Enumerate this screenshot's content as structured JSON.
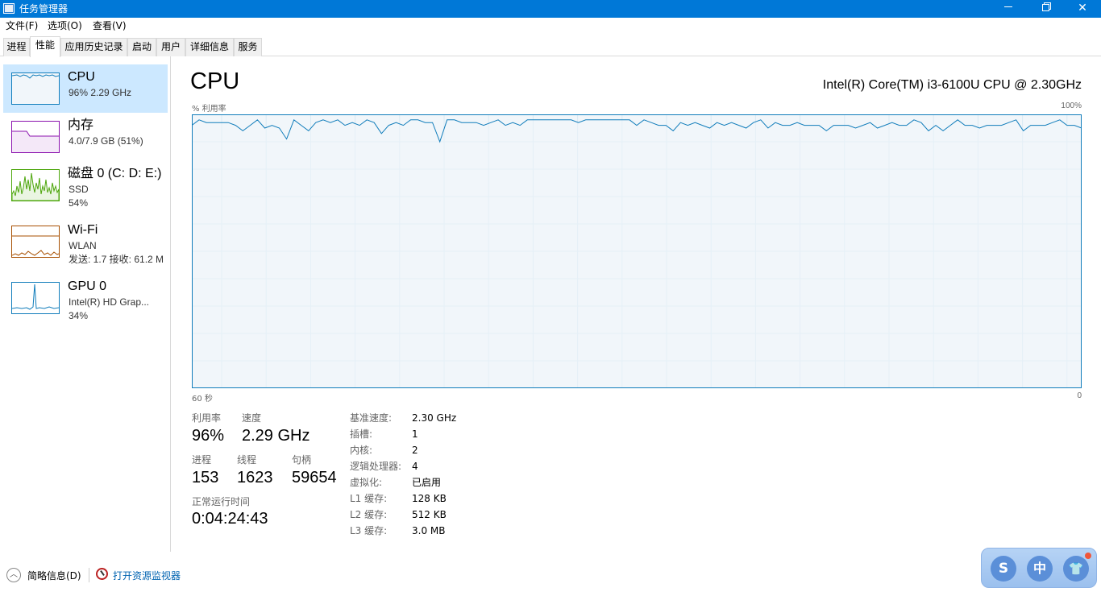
{
  "window": {
    "title": "任务管理器"
  },
  "menu": [
    "文件(F)",
    "选项(O)",
    "查看(V)"
  ],
  "tabs": [
    "进程",
    "性能",
    "应用历史记录",
    "启动",
    "用户",
    "详细信息",
    "服务"
  ],
  "active_tab": "性能",
  "sidebar": {
    "items": [
      {
        "title": "CPU",
        "line1": "96% 2.29 GHz",
        "line2": "",
        "color": "#117dbb"
      },
      {
        "title": "内存",
        "line1": "4.0/7.9 GB (51%)",
        "line2": "",
        "color": "#8b12ae"
      },
      {
        "title": "磁盘 0 (C: D: E:)",
        "line1": "SSD",
        "line2": "54%",
        "color": "#4da60c"
      },
      {
        "title": "Wi-Fi",
        "line1": "WLAN",
        "line2": "发送: 1.7 接收: 61.2 M",
        "color": "#a74f01"
      },
      {
        "title": "GPU 0",
        "line1": "Intel(R) HD Grap...",
        "line2": "34%",
        "color": "#117dbb"
      }
    ]
  },
  "main": {
    "title": "CPU",
    "cpu_name": "Intel(R) Core(TM) i3-6100U CPU @ 2.30GHz",
    "axis_label": "% 利用率",
    "axis_max": "100%",
    "axis_time_left": "60 秒",
    "axis_time_right": "0",
    "utilization_label": "利用率",
    "utilization": "96%",
    "speed_label": "速度",
    "speed": "2.29 GHz",
    "processes_label": "进程",
    "processes": "153",
    "threads_label": "线程",
    "threads": "1623",
    "handles_label": "句柄",
    "handles": "59654",
    "uptime_label": "正常运行时间",
    "uptime": "0:04:24:43",
    "info": [
      {
        "label": "基准速度:",
        "value": "2.30 GHz"
      },
      {
        "label": "插槽:",
        "value": "1"
      },
      {
        "label": "内核:",
        "value": "2"
      },
      {
        "label": "逻辑处理器:",
        "value": "4"
      },
      {
        "label": "虚拟化:",
        "value": "已启用"
      },
      {
        "label": "L1 缓存:",
        "value": "128 KB"
      },
      {
        "label": "L2 缓存:",
        "value": "512 KB"
      },
      {
        "label": "L3 缓存:",
        "value": "3.0 MB"
      }
    ]
  },
  "footer": {
    "summary": "简略信息(D)",
    "resmon": "打开资源监视器"
  },
  "ime": {
    "btn1": "S",
    "btn2": "中",
    "btn3": "👕"
  },
  "chart_data": {
    "type": "line",
    "ylim": [
      0,
      100
    ],
    "series": [
      {
        "values": [
          96,
          98,
          97,
          97,
          97,
          97,
          96,
          94,
          96,
          98,
          95,
          96,
          95,
          91,
          98,
          96,
          94,
          97,
          98,
          97,
          98,
          96,
          97,
          96,
          98,
          97,
          93,
          96,
          97,
          96,
          98,
          98,
          97,
          97,
          90,
          98,
          98,
          97,
          97,
          97,
          96,
          97,
          98,
          96,
          97,
          96,
          98,
          98,
          98,
          98,
          98,
          98,
          98,
          97,
          98,
          98,
          98,
          98,
          98,
          98,
          98,
          96,
          98,
          97,
          96,
          96,
          94,
          97,
          96,
          97,
          96,
          95,
          97,
          96,
          97,
          96,
          95,
          97,
          98,
          95,
          97,
          96,
          96,
          97,
          96,
          96,
          96,
          94,
          96,
          96,
          96,
          95,
          96,
          97,
          95,
          96,
          97,
          96,
          96,
          98,
          97,
          94,
          96,
          94,
          96,
          98,
          96,
          96,
          95,
          96,
          96,
          96,
          97,
          98,
          94,
          96,
          96,
          96,
          97,
          98,
          96,
          96,
          95
        ]
      }
    ]
  }
}
